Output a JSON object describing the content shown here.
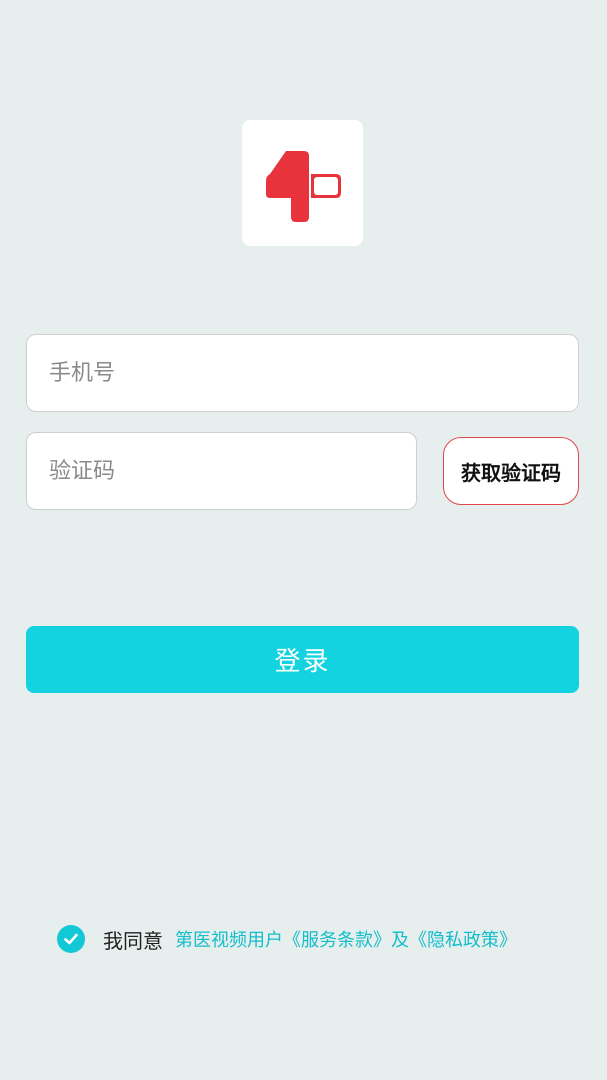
{
  "logo": {
    "icon": "plus-one-logo-icon",
    "color": "#e8323c"
  },
  "form": {
    "phone_placeholder": "手机号",
    "code_placeholder": "验证码",
    "get_code_label": "获取验证码",
    "login_label": "登录"
  },
  "agreement": {
    "checked": true,
    "prefix": "我同意",
    "terms_link": "第医视频用户《服务条款》",
    "conjunction": "及",
    "privacy_link": "《隐私政策》"
  },
  "colors": {
    "background": "#e6efee",
    "accent": "#12d3df",
    "link": "#14bdca",
    "brand_red": "#e8323c"
  }
}
